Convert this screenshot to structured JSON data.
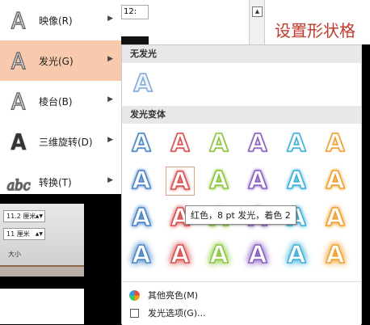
{
  "left_menu": [
    {
      "icon": "A",
      "label": "映像(R)",
      "active": false
    },
    {
      "icon": "A",
      "label": "发光(G)",
      "active": true
    },
    {
      "icon": "A",
      "label": "棱台(B)",
      "active": false
    },
    {
      "icon": "A",
      "label": "三维旋转(D)",
      "active": false
    },
    {
      "icon": "abc",
      "label": "转换(T)",
      "active": false
    }
  ],
  "ribbon": {
    "height_value": "11.2 厘米",
    "width_value": "11 厘米",
    "group_label": "大小"
  },
  "topbar": {
    "field_value": "12:",
    "title": "设置形状格"
  },
  "panel": {
    "section_none": "无发光",
    "section_variants": "发光变体",
    "tooltip": "红色，8 pt 发光，着色 2",
    "glow_colors": [
      "#4a86c8",
      "#d94f4f",
      "#8cc63e",
      "#8a5fc4",
      "#3fb0d8",
      "#f0a030"
    ],
    "footer_more_colors": "其他亮色(M)",
    "footer_options": "发光选项(G)..."
  }
}
